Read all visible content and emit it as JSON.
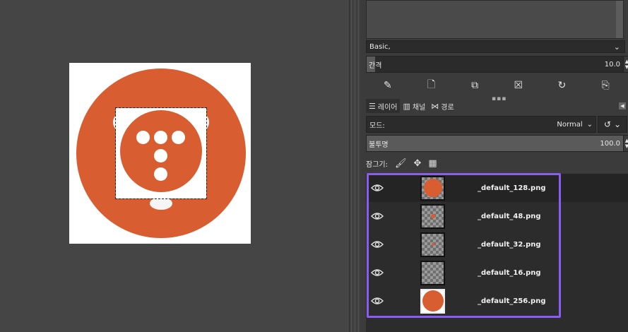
{
  "brushes": {
    "preset_value": "Basic,",
    "spacing_label": "간격",
    "spacing_value": "10.0"
  },
  "brush_actions": [
    "edit-brush-icon",
    "new-brush-icon",
    "duplicate-brush-icon",
    "delete-brush-icon",
    "refresh-brushes-icon",
    "open-as-image-icon"
  ],
  "tabs": [
    {
      "label": "레이어",
      "icon": "layers-tab-icon"
    },
    {
      "label": "채널",
      "icon": "channels-tab-icon"
    },
    {
      "label": "경로",
      "icon": "paths-tab-icon"
    }
  ],
  "layers_panel": {
    "mode_label": "모드:",
    "mode_value": "Normal",
    "opacity_label": "불투명",
    "opacity_value": "100.0",
    "opacity_fraction": 1.0,
    "lock_label": "잠그기:"
  },
  "layers": [
    {
      "name": "_default_128.png",
      "selected": true
    },
    {
      "name": "_default_48.png",
      "selected": false
    },
    {
      "name": "_default_32.png",
      "selected": false
    },
    {
      "name": "_default_16.png",
      "selected": false
    },
    {
      "name": "_default_256.png",
      "selected": false
    }
  ],
  "colors": {
    "accent_orange": "#d85d31",
    "highlight_purple": "#8a5cf0",
    "background": "#454545"
  }
}
